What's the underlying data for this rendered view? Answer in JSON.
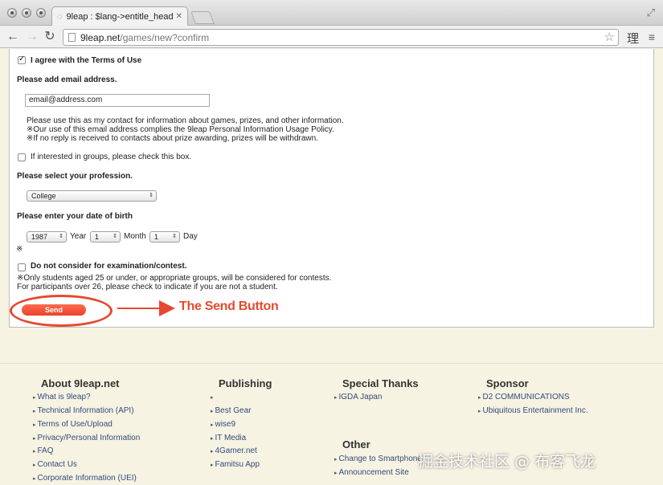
{
  "browser": {
    "tab_title": "9leap : $lang->entitle_head",
    "url_host": "9leap.net",
    "url_path": "/games/new?confirm",
    "extension_glyph": "理"
  },
  "form": {
    "agree_terms": "I agree with the Terms of Use",
    "email_heading": "Please add email address.",
    "email_value": "email@address.com",
    "email_note_1": "Please use this as my contact for information about games, prizes, and other information.",
    "email_note_2": "※Our use of this email address complies the 9leap Personal Information Usage Policy.",
    "email_note_3": "※If no reply is received to contacts about prize awarding, prizes will be withdrawn.",
    "groups_label": "If interested in groups, please check this box.",
    "profession_heading": "Please select your profession.",
    "profession_value": "College",
    "dob_heading": "Please enter your date of birth",
    "year_value": "1987",
    "year_label": "Year",
    "month_value": "1",
    "month_label": "Month",
    "day_value": "1",
    "day_label": "Day",
    "asterisk": "※",
    "contest_label": "Do not consider for examination/contest.",
    "contest_note_1": "※Only students aged 25 or under, or appropriate groups, will be considered for contests.",
    "contest_note_2": "For participants over 26, please check to indicate if you are not a student.",
    "send_label": "Send",
    "annotation": "The Send Button"
  },
  "footer": {
    "about": {
      "heading": "About 9leap.net",
      "links": [
        "What is 9leap?",
        "Technical Information (API)",
        "Terms of Use/Upload",
        "Privacy/Personal Information",
        "FAQ",
        "Contact Us",
        "Corporate Information (UEI)"
      ]
    },
    "publishing": {
      "heading": "Publishing",
      "links": [
        "",
        "Best Gear",
        "wise9",
        "IT Media",
        "4Gamer.net",
        "Famitsu App"
      ]
    },
    "thanks": {
      "heading": "Special Thanks",
      "links": [
        "IGDA Japan"
      ]
    },
    "other": {
      "heading": "Other",
      "links": [
        "Change to Smartphone",
        "Announcement Site"
      ]
    },
    "sponsor": {
      "heading": "Sponsor",
      "links": [
        "D2 COMMUNICATIONS",
        "Ubiquitous Entertainment Inc."
      ]
    }
  },
  "watermark": "掘金技术社区 @ 布客飞龙",
  "colors": {
    "accent_red": "#e5492f",
    "link_blue": "#334a7a",
    "footer_bg": "#f6f3e3"
  }
}
